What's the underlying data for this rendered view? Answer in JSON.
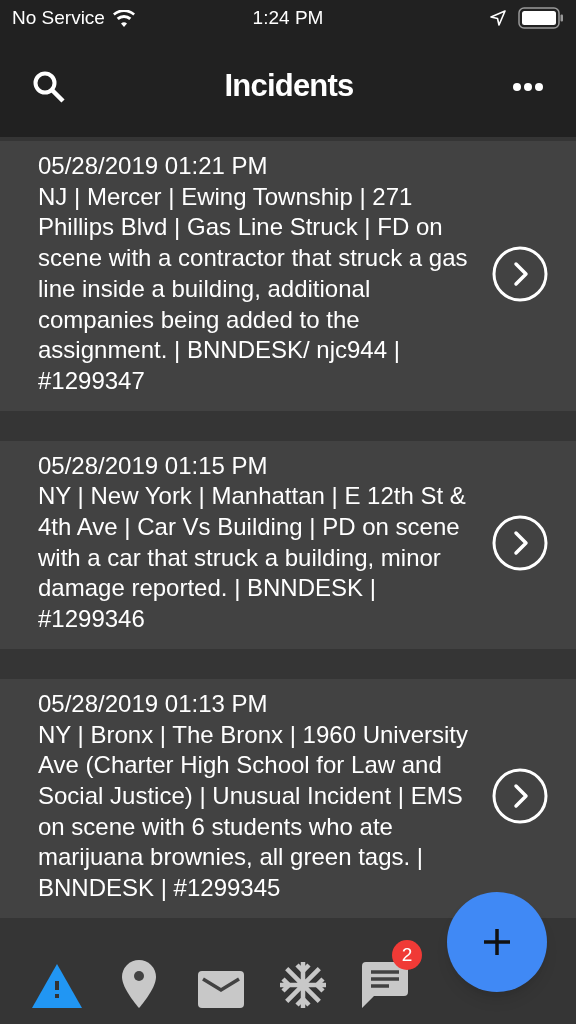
{
  "status_bar": {
    "carrier": "No Service",
    "time": "1:24 PM"
  },
  "header": {
    "title": "Incidents"
  },
  "incidents": [
    {
      "datetime": "05/28/2019 01:21 PM",
      "text": "NJ | Mercer | Ewing Township | 271 Phillips Blvd | Gas Line Struck | FD on scene with a contractor that struck a gas line inside a building, additional companies being added to the assignment. | BNNDESK/ njc944 | #1299347"
    },
    {
      "datetime": "05/28/2019 01:15 PM",
      "text": "NY | New York | Manhattan | E 12th St & 4th Ave | Car Vs Building | PD on scene with a car that struck a building, minor damage reported. | BNNDESK | #1299346"
    },
    {
      "datetime": "05/28/2019 01:13 PM",
      "text": "NY | Bronx | The Bronx | 1960 University Ave (Charter High School for Law and Social Justice) | Unusual Incident | EMS on scene with 6 students who ate marijuana brownies, all green tags.  | BNNDESK | #1299345"
    }
  ],
  "tabs": [
    {
      "kind": "alert",
      "selected": true
    },
    {
      "kind": "pin",
      "selected": false
    },
    {
      "kind": "mail",
      "selected": false
    },
    {
      "kind": "snow",
      "selected": false
    },
    {
      "kind": "chat",
      "selected": false,
      "badge": "2"
    }
  ]
}
